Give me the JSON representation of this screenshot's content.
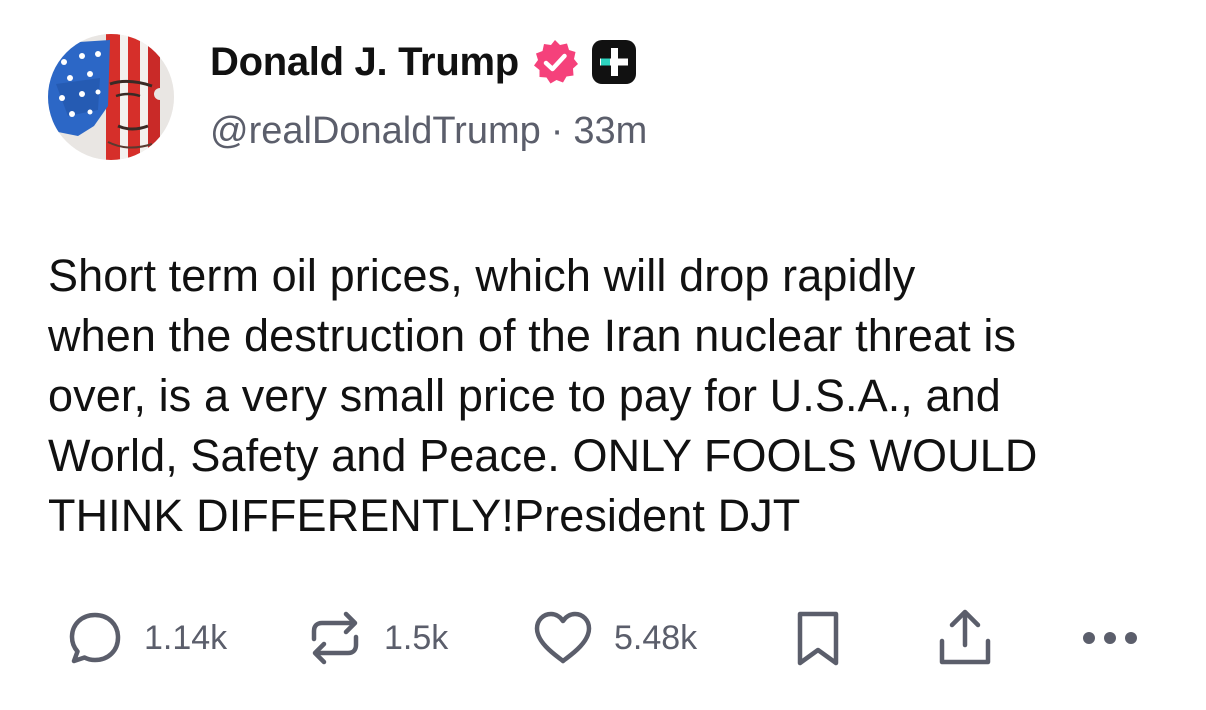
{
  "author": {
    "display_name": "Donald J. Trump",
    "handle": "@realDonaldTrump",
    "separator": "·",
    "time_ago": "33m",
    "verified_color": "#f5417b"
  },
  "post": {
    "text": "Short term oil prices, which will drop rapidly\nwhen the destruction of the Iran nuclear threat is\nover, is a very small price to pay for U.S.A., and\nWorld, Safety and Peace. ONLY FOOLS WOULD\nTHINK DIFFERENTLY!President DJT"
  },
  "actions": {
    "replies": "1.14k",
    "reposts": "1.5k",
    "likes": "5.48k",
    "icons": [
      "comment-icon",
      "repost-icon",
      "heart-icon",
      "bookmark-icon",
      "share-icon",
      "more-icon"
    ],
    "icon_color": "#5b5e6b"
  }
}
